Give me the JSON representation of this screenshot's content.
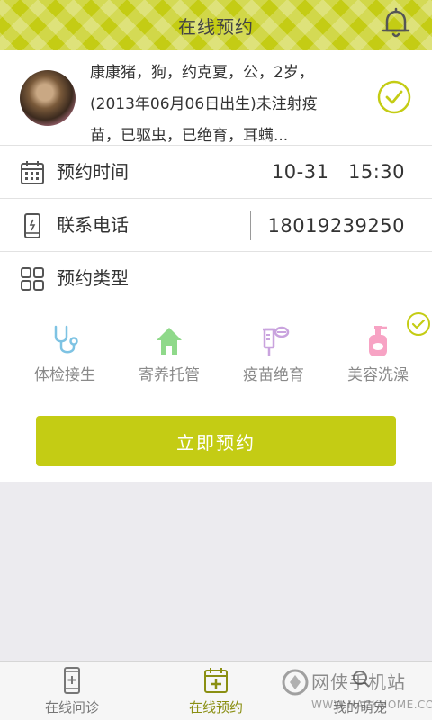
{
  "header": {
    "title": "在线预约"
  },
  "pet": {
    "line1": "康康猪，狗，约克夏，公，2岁，",
    "line2": "(2013年06月06日出生)未注射疫",
    "line3": "苗，已驱虫，已绝育，耳螨..."
  },
  "form": {
    "time_label": "预约时间",
    "time_value": "10-31   15:30",
    "phone_label": "联系电话",
    "phone_value": "18019239250",
    "type_label": "预约类型"
  },
  "types": [
    {
      "label": "体检接生",
      "icon": "stethoscope-icon",
      "color": "#7ec3e3"
    },
    {
      "label": "寄养托管",
      "icon": "house-icon",
      "color": "#8fd98a"
    },
    {
      "label": "疫苗绝育",
      "icon": "syringe-icon",
      "color": "#c9a3de"
    },
    {
      "label": "美容洗澡",
      "icon": "shampoo-bottle-icon",
      "color": "#f7a3c4",
      "selected": true
    }
  ],
  "submit_label": "立即预约",
  "nav": {
    "items": [
      {
        "label": "在线问诊",
        "icon": "phone-plus-icon",
        "active": false
      },
      {
        "label": "在线预约",
        "icon": "calendar-plus-icon",
        "active": true
      },
      {
        "label": "我的萌宠",
        "icon": "pet-icon",
        "active": false
      }
    ]
  },
  "watermark": {
    "big": "网侠手机站",
    "small": "WWW.HACKHOME.COM"
  },
  "colors": {
    "accent": "#c4cc14",
    "background": "#ecebef",
    "active_nav": "#8a8f12"
  }
}
